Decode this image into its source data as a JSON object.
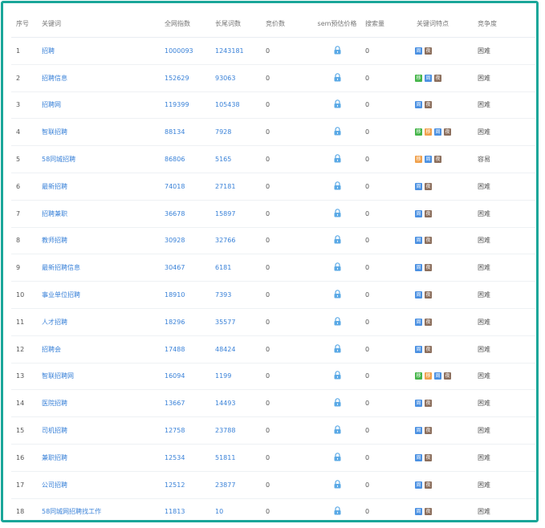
{
  "columns": {
    "index": "序号",
    "keyword": "关键词",
    "all_index": "全网指数",
    "long_tail": "长尾词数",
    "bid_count": "竞价数",
    "sem_price": "sem预估价格",
    "search_volume": "搜索量",
    "features": "关键词特点",
    "competition": "竞争度"
  },
  "badge_types": {
    "zhou": {
      "label": "周",
      "color": "#4a90e2"
    },
    "ye": {
      "label": "夜",
      "color": "#8b6e5c"
    },
    "yi": {
      "label": "移",
      "color": "#44b549"
    },
    "duo": {
      "label": "移",
      "color": "#f0a04b"
    }
  },
  "rows": [
    {
      "index": "1",
      "keyword": "招聘",
      "all": "1000093",
      "long": "1243181",
      "bid": "0",
      "vol": "0",
      "badges": [
        "zhou",
        "ye"
      ],
      "competition": "困难"
    },
    {
      "index": "2",
      "keyword": "招聘信息",
      "all": "152629",
      "long": "93063",
      "bid": "0",
      "vol": "0",
      "badges": [
        "yi",
        "zhou",
        "ye"
      ],
      "competition": "困难"
    },
    {
      "index": "3",
      "keyword": "招聘网",
      "all": "119399",
      "long": "105438",
      "bid": "0",
      "vol": "0",
      "badges": [
        "zhou",
        "ye"
      ],
      "competition": "困难"
    },
    {
      "index": "4",
      "keyword": "智联招聘",
      "all": "88134",
      "long": "7928",
      "bid": "0",
      "vol": "0",
      "badges": [
        "yi",
        "duo",
        "zhou",
        "ye"
      ],
      "competition": "困难"
    },
    {
      "index": "5",
      "keyword": "58同城招聘",
      "all": "86806",
      "long": "5165",
      "bid": "0",
      "vol": "0",
      "badges": [
        "duo",
        "zhou",
        "ye"
      ],
      "competition": "容易"
    },
    {
      "index": "6",
      "keyword": "最新招聘",
      "all": "74018",
      "long": "27181",
      "bid": "0",
      "vol": "0",
      "badges": [
        "zhou",
        "ye"
      ],
      "competition": "困难"
    },
    {
      "index": "7",
      "keyword": "招聘兼职",
      "all": "36678",
      "long": "15897",
      "bid": "0",
      "vol": "0",
      "badges": [
        "zhou",
        "ye"
      ],
      "competition": "困难"
    },
    {
      "index": "8",
      "keyword": "教师招聘",
      "all": "30928",
      "long": "32766",
      "bid": "0",
      "vol": "0",
      "badges": [
        "zhou",
        "ye"
      ],
      "competition": "困难"
    },
    {
      "index": "9",
      "keyword": "最新招聘信息",
      "all": "30467",
      "long": "6181",
      "bid": "0",
      "vol": "0",
      "badges": [
        "zhou",
        "ye"
      ],
      "competition": "困难"
    },
    {
      "index": "10",
      "keyword": "事业单位招聘",
      "all": "18910",
      "long": "7393",
      "bid": "0",
      "vol": "0",
      "badges": [
        "zhou",
        "ye"
      ],
      "competition": "困难"
    },
    {
      "index": "11",
      "keyword": "人才招聘",
      "all": "18296",
      "long": "35577",
      "bid": "0",
      "vol": "0",
      "badges": [
        "zhou",
        "ye"
      ],
      "competition": "困难"
    },
    {
      "index": "12",
      "keyword": "招聘会",
      "all": "17488",
      "long": "48424",
      "bid": "0",
      "vol": "0",
      "badges": [
        "zhou",
        "ye"
      ],
      "competition": "困难"
    },
    {
      "index": "13",
      "keyword": "智联招聘网",
      "all": "16094",
      "long": "1199",
      "bid": "0",
      "vol": "0",
      "badges": [
        "yi",
        "duo",
        "zhou",
        "ye"
      ],
      "competition": "困难"
    },
    {
      "index": "14",
      "keyword": "医院招聘",
      "all": "13667",
      "long": "14493",
      "bid": "0",
      "vol": "0",
      "badges": [
        "zhou",
        "ye"
      ],
      "competition": "困难"
    },
    {
      "index": "15",
      "keyword": "司机招聘",
      "all": "12758",
      "long": "23788",
      "bid": "0",
      "vol": "0",
      "badges": [
        "zhou",
        "ye"
      ],
      "competition": "困难"
    },
    {
      "index": "16",
      "keyword": "兼职招聘",
      "all": "12534",
      "long": "51811",
      "bid": "0",
      "vol": "0",
      "badges": [
        "zhou",
        "ye"
      ],
      "competition": "困难"
    },
    {
      "index": "17",
      "keyword": "公司招聘",
      "all": "12512",
      "long": "23877",
      "bid": "0",
      "vol": "0",
      "badges": [
        "zhou",
        "ye"
      ],
      "competition": "困难"
    },
    {
      "index": "18",
      "keyword": "58同城网招聘找工作",
      "all": "11813",
      "long": "10",
      "bid": "0",
      "vol": "0",
      "badges": [
        "zhou",
        "ye"
      ],
      "competition": "困难"
    }
  ]
}
